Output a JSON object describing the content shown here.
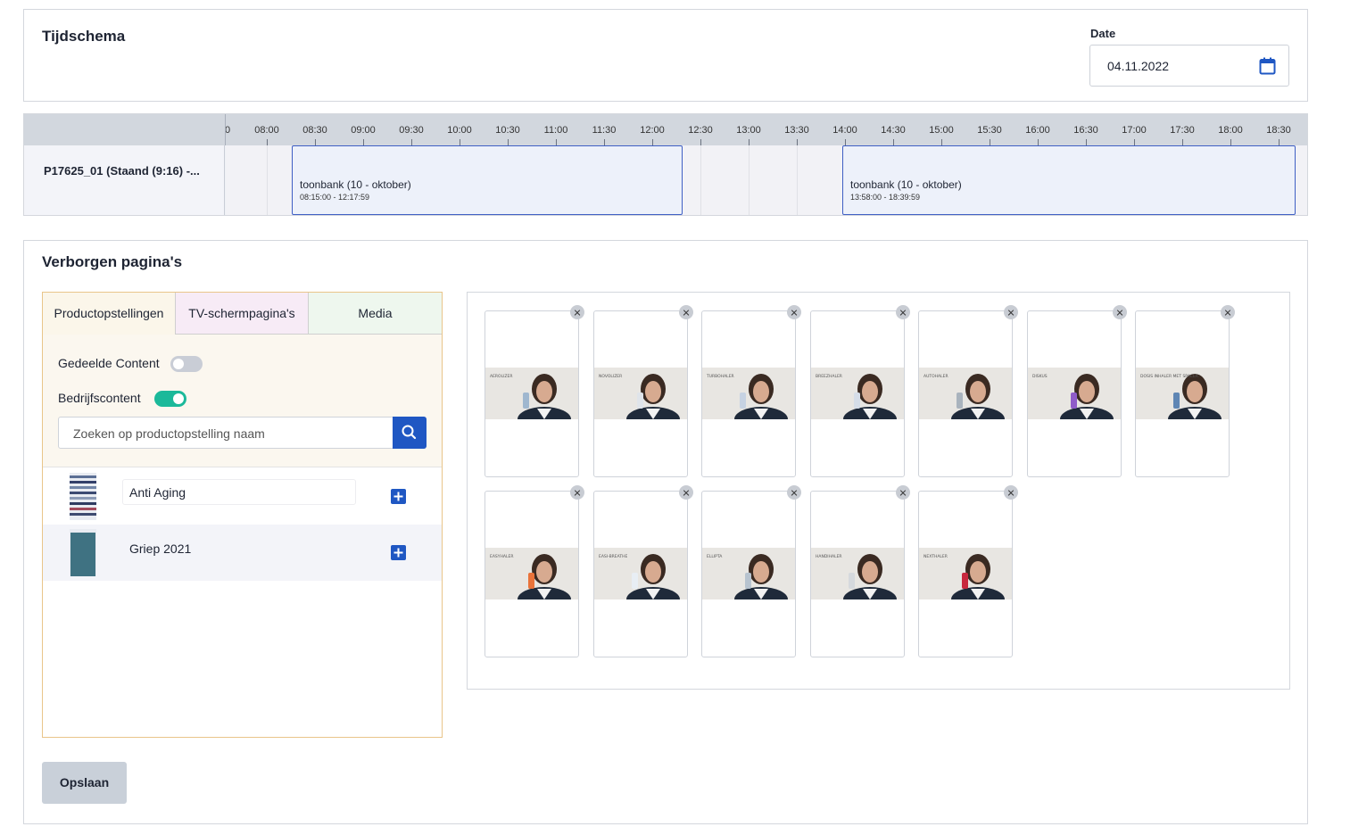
{
  "schedule": {
    "title": "Tijdschema",
    "date_label": "Date",
    "date_value": "04.11.2022"
  },
  "timeline": {
    "row_label": "P17625_01 (Staand (9:16) -...",
    "hours": [
      "0",
      "08:00",
      "08:30",
      "09:00",
      "09:30",
      "10:00",
      "10:30",
      "11:00",
      "11:30",
      "12:00",
      "12:30",
      "13:00",
      "13:30",
      "14:00",
      "14:30",
      "15:00",
      "15:30",
      "16:00",
      "16:30",
      "17:00",
      "17:30",
      "18:00",
      "18:30"
    ],
    "events": [
      {
        "title": "toonbank (10 - oktober)",
        "time": "08:15:00 - 12:17:59"
      },
      {
        "title": "toonbank (10 - oktober)",
        "time": "13:58:00 - 18:39:59"
      }
    ]
  },
  "hidden": {
    "title": "Verborgen pagina's",
    "tabs": [
      "Productopstellingen",
      "TV-schermpagina's",
      "Media"
    ],
    "shared_content": {
      "label": "Gedeelde Content",
      "on": false
    },
    "company_content": {
      "label": "Bedrijfscontent",
      "on": true
    },
    "search_placeholder": "Zoeken op productopstelling naam",
    "items": [
      {
        "name": "Anti Aging"
      },
      {
        "name": "Griep 2021"
      }
    ],
    "media_tiles": [
      {
        "caption": "AEROLIZER",
        "device_color": "#9fb7cf"
      },
      {
        "caption": "NOVOLIZER",
        "device_color": "#dfe4ea"
      },
      {
        "caption": "TURBOHALER",
        "device_color": "#c6d2e2"
      },
      {
        "caption": "BREEZHALER",
        "device_color": "#d5dde8"
      },
      {
        "caption": "AUTOHALER",
        "device_color": "#a9b3bd"
      },
      {
        "caption": "DISKUS",
        "device_color": "#8f5cc9"
      },
      {
        "caption": "DOSIS INHALER MET SPACER",
        "device_color": "#5f86b4"
      },
      {
        "caption": "EASYHALER",
        "device_color": "#e9733a"
      },
      {
        "caption": "EASI-BREATHE",
        "device_color": "#e8eef4"
      },
      {
        "caption": "ELLIPTA",
        "device_color": "#b7c3cf"
      },
      {
        "caption": "HANDIHALER",
        "device_color": "#d5d9dd"
      },
      {
        "caption": "NEXTHALER",
        "device_color": "#c8283e"
      }
    ],
    "save_label": "Opslaan"
  },
  "colors": {
    "primary": "#1f57c3",
    "toggle_on": "#1bb99a",
    "toggle_off": "#c9cdd6",
    "event_border": "#3f5fc4"
  }
}
